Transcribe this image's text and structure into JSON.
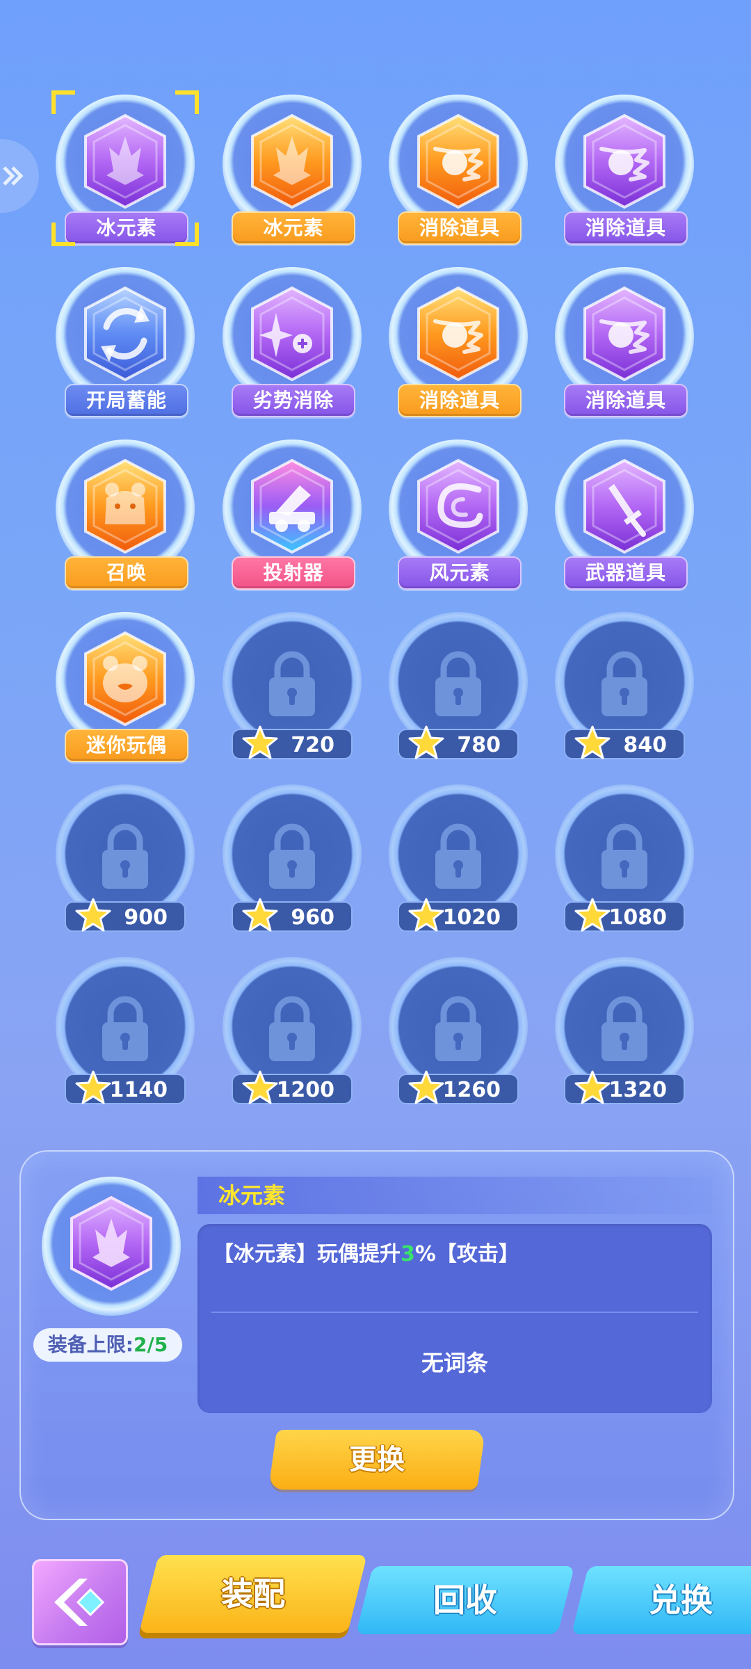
{
  "slots": [
    {
      "type": "item",
      "label": "冰元素",
      "hex": "purple",
      "icon": "crystal-icon",
      "label_color": "purple",
      "selected": true
    },
    {
      "type": "item",
      "label": "冰元素",
      "hex": "orange",
      "icon": "crystal-icon",
      "label_color": "orange"
    },
    {
      "type": "item",
      "label": "消除道具",
      "hex": "orange",
      "icon": "fireball-icon",
      "label_color": "orange"
    },
    {
      "type": "item",
      "label": "消除道具",
      "hex": "purple",
      "icon": "fireball-icon",
      "label_color": "purple"
    },
    {
      "type": "item",
      "label": "开局蓄能",
      "hex": "blue",
      "icon": "refresh-cycle-icon",
      "label_color": "blue"
    },
    {
      "type": "item",
      "label": "劣势消除",
      "hex": "purple",
      "icon": "sparkle-plus-icon",
      "label_color": "purple"
    },
    {
      "type": "item",
      "label": "消除道具",
      "hex": "orange",
      "icon": "fireball-icon",
      "label_color": "orange"
    },
    {
      "type": "item",
      "label": "消除道具",
      "hex": "purple",
      "icon": "fireball-icon",
      "label_color": "purple"
    },
    {
      "type": "item",
      "label": "召唤",
      "hex": "orange",
      "icon": "bear-icon",
      "label_color": "orange"
    },
    {
      "type": "item",
      "label": "投射器",
      "hex": "rainbow",
      "icon": "cannon-icon",
      "label_color": "pink"
    },
    {
      "type": "item",
      "label": "风元素",
      "hex": "purple",
      "icon": "wind-swirl-icon",
      "label_color": "purple"
    },
    {
      "type": "item",
      "label": "武器道具",
      "hex": "purple",
      "icon": "sword-icon",
      "label_color": "purple"
    },
    {
      "type": "item",
      "label": "迷你玩偶",
      "hex": "orange",
      "icon": "bear-face-icon",
      "label_color": "orange"
    },
    {
      "type": "locked",
      "price": "720"
    },
    {
      "type": "locked",
      "price": "780"
    },
    {
      "type": "locked",
      "price": "840"
    },
    {
      "type": "locked",
      "price": "900"
    },
    {
      "type": "locked",
      "price": "960"
    },
    {
      "type": "locked",
      "price": "1020"
    },
    {
      "type": "locked",
      "price": "1080"
    },
    {
      "type": "locked",
      "price": "1140"
    },
    {
      "type": "locked",
      "price": "1200"
    },
    {
      "type": "locked",
      "price": "1260"
    },
    {
      "type": "locked",
      "price": "1320"
    }
  ],
  "detail": {
    "name": "冰元素",
    "desc_prefix": "【冰元素】玩偶提升",
    "desc_value": "3",
    "desc_suffix": "%【攻击】",
    "no_entry": "无词条",
    "limit_label": "装备上限:",
    "limit_count": "2/5",
    "swap_label": "更换"
  },
  "bottom": {
    "equip": "装配",
    "recycle": "回收",
    "exchange": "兑换"
  },
  "colors": {
    "purple": [
      "#e3b6ff",
      "#b367f4",
      "#7a2fd6"
    ],
    "orange": [
      "#ffe07a",
      "#ff9a1f",
      "#f05a0c"
    ],
    "blue": [
      "#b6d4ff",
      "#5f8cf4",
      "#3c5ad8"
    ],
    "rainbow": [
      "#ff8de1",
      "#9b5df5",
      "#39c6ff"
    ]
  }
}
